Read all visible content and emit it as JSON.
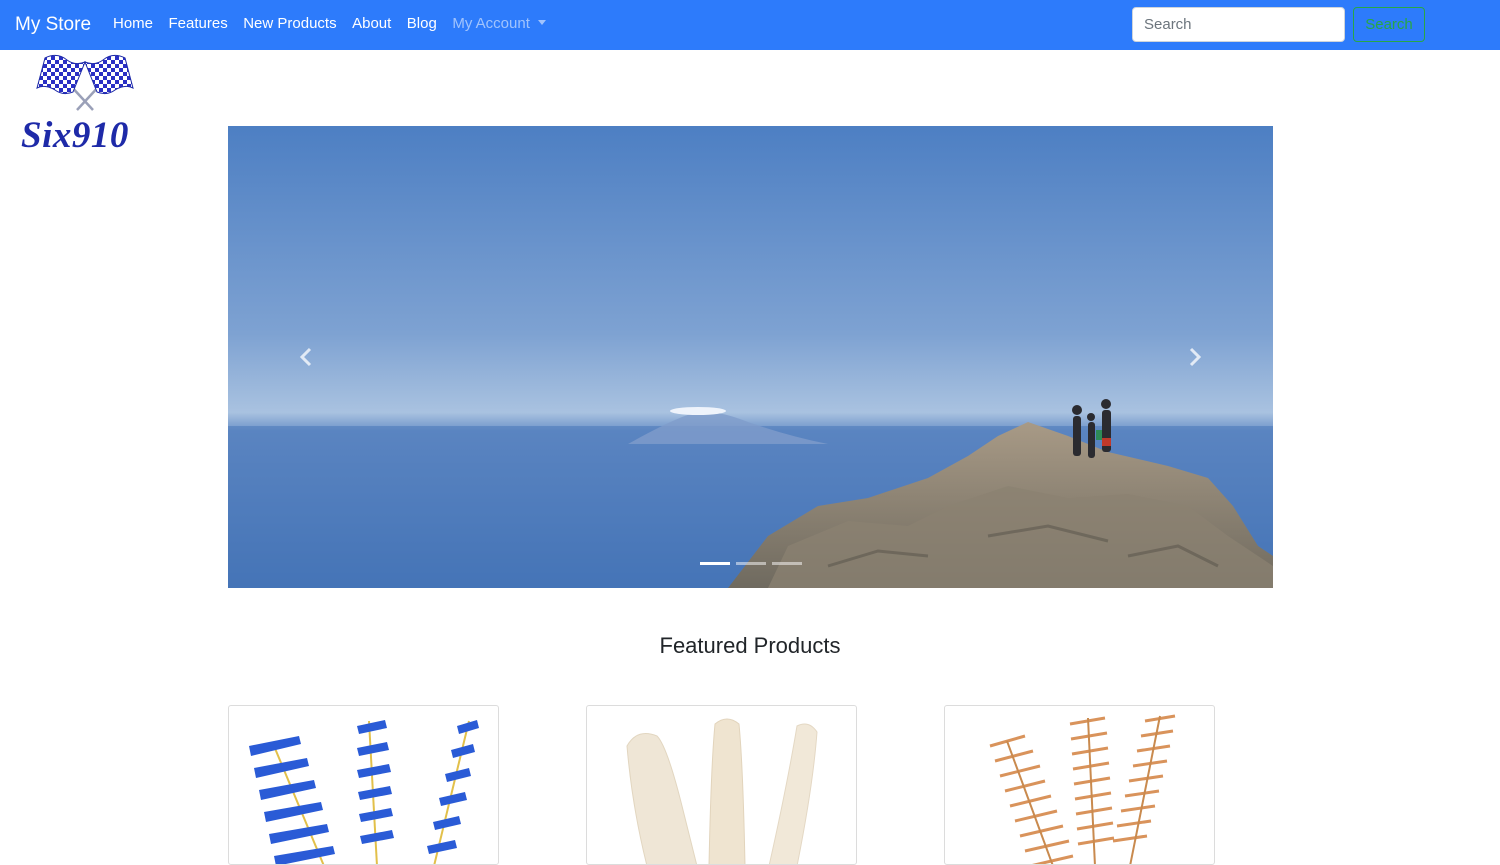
{
  "navbar": {
    "brand": "My Store",
    "links": [
      {
        "label": "Home"
      },
      {
        "label": "Features"
      },
      {
        "label": "New Products"
      },
      {
        "label": "About"
      },
      {
        "label": "Blog"
      },
      {
        "label": "My Account"
      }
    ],
    "search": {
      "placeholder": "Search",
      "value": "",
      "button_label": "Search"
    },
    "colors": {
      "background": "#2d7bfb",
      "search_button": "#28a745"
    }
  },
  "logo": {
    "text": "Six910",
    "icon": "crossed-checkered-flags"
  },
  "carousel": {
    "slide_image": "mountain-summit-hikers-over-sea",
    "prev_icon": "chevron-left-icon",
    "next_icon": "chevron-right-icon",
    "indicator_count": 3,
    "active_indicator": 1
  },
  "featured": {
    "title": "Featured Products",
    "products": [
      {
        "image": "blue-nylon-bore-brushes"
      },
      {
        "image": "felt-bore-mops"
      },
      {
        "image": "bronze-bore-brushes"
      }
    ]
  }
}
